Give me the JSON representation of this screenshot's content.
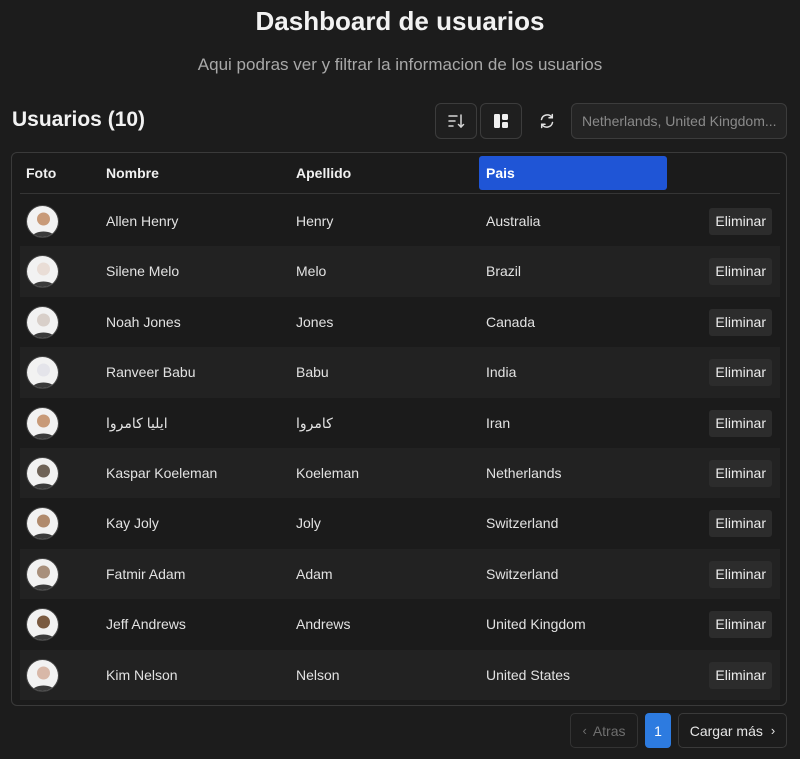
{
  "header": {
    "title": "Dashboard de usuarios",
    "subtitle": "Aqui podras ver y filtrar la informacion de los usuarios"
  },
  "toolbar": {
    "heading": "Usuarios (10)",
    "sort_icon": "sort-icon",
    "grid_icon": "grid-icon",
    "refresh_icon": "refresh-icon",
    "search_placeholder": "Netherlands, United Kingdom...",
    "search_value": ""
  },
  "table": {
    "headers": {
      "foto": "Foto",
      "nombre": "Nombre",
      "apellido": "Apellido",
      "pais": "Pais"
    },
    "highlighted_column_color": "#1f55d6",
    "rows": [
      {
        "nombre": "Allen Henry",
        "apellido": "Henry",
        "pais": "Australia",
        "action": "Eliminar",
        "avatar_color": "#c89a78"
      },
      {
        "nombre": "Silene Melo",
        "apellido": "Melo",
        "pais": "Brazil",
        "action": "Eliminar",
        "avatar_color": "#e9ddd6"
      },
      {
        "nombre": "Noah Jones",
        "apellido": "Jones",
        "pais": "Canada",
        "action": "Eliminar",
        "avatar_color": "#d8cfc9"
      },
      {
        "nombre": "Ranveer Babu",
        "apellido": "Babu",
        "pais": "India",
        "action": "Eliminar",
        "avatar_color": "#e4e4ea"
      },
      {
        "nombre": "ایلیا کامروا",
        "apellido": "کامروا",
        "pais": "Iran",
        "action": "Eliminar",
        "avatar_color": "#c89a78"
      },
      {
        "nombre": "Kaspar Koeleman",
        "apellido": "Koeleman",
        "pais": "Netherlands",
        "action": "Eliminar",
        "avatar_color": "#6f6357"
      },
      {
        "nombre": "Kay Joly",
        "apellido": "Joly",
        "pais": "Switzerland",
        "action": "Eliminar",
        "avatar_color": "#b08a6c"
      },
      {
        "nombre": "Fatmir Adam",
        "apellido": "Adam",
        "pais": "Switzerland",
        "action": "Eliminar",
        "avatar_color": "#a88f7b"
      },
      {
        "nombre": "Jeff Andrews",
        "apellido": "Andrews",
        "pais": "United Kingdom",
        "action": "Eliminar",
        "avatar_color": "#7a5a40"
      },
      {
        "nombre": "Kim Nelson",
        "apellido": "Nelson",
        "pais": "United States",
        "action": "Eliminar",
        "avatar_color": "#d8b8a8"
      }
    ]
  },
  "pagination": {
    "prev_label": "Atras",
    "current_page": "1",
    "next_label": "Cargar más",
    "accent_color": "#2d7be0"
  }
}
